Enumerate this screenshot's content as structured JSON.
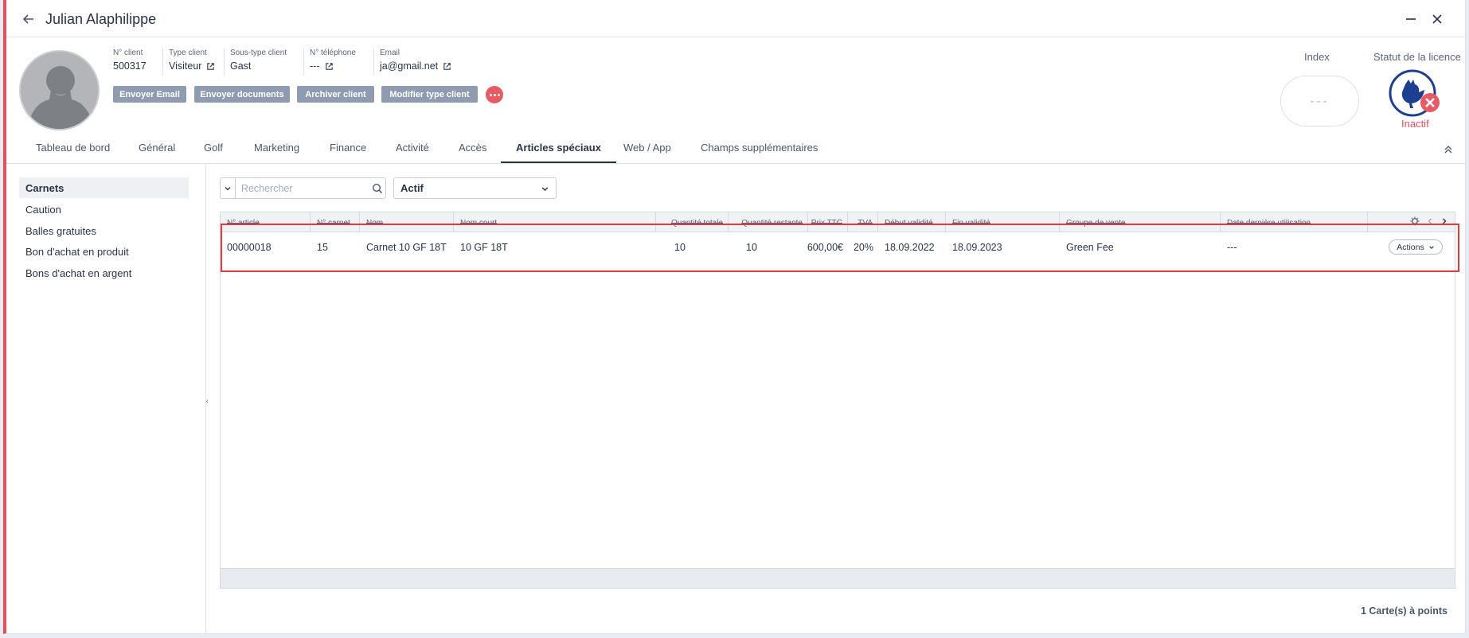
{
  "window": {
    "title": "Julian Alaphilippe"
  },
  "client": {
    "fields": [
      {
        "label": "N° client",
        "value": "500317",
        "link": false
      },
      {
        "label": "Type client",
        "value": "Visiteur",
        "link": true
      },
      {
        "label": "Sous-type client",
        "value": "Gast",
        "link": false
      },
      {
        "label": "N° téléphone",
        "value": "---",
        "link": true
      },
      {
        "label": "Email",
        "value": "ja@gmail.net",
        "link": true
      }
    ],
    "buttons": [
      "Envoyer Email",
      "Envoyer documents",
      "Archiver client",
      "Modifier type client"
    ],
    "index": {
      "label": "Index",
      "value": "---"
    },
    "license": {
      "label": "Statut de la licence",
      "status": "Inactif"
    }
  },
  "tabs": [
    "Tableau de bord",
    "Général",
    "Golf",
    "Marketing",
    "Finance",
    "Activité",
    "Accès",
    "Articles spéciaux",
    "Web / App",
    "Champs supplémentaires"
  ],
  "active_tab": "Articles spéciaux",
  "sidebar": {
    "items": [
      "Carnets",
      "Caution",
      "Balles gratuites",
      "Bon d'achat en produit",
      "Bons d'achat en argent"
    ],
    "active": "Carnets"
  },
  "toolbar": {
    "search_placeholder": "Rechercher",
    "status_filter": "Actif"
  },
  "table": {
    "columns": [
      "N° article",
      "N° carnet",
      "Nom",
      "Nom court",
      "Quantité totale",
      "Quantité restante",
      "Prix TTC",
      "TVA",
      "Début validité",
      "Fin validité",
      "Groupe de vente",
      "Date dernière utilisation"
    ],
    "rows": [
      {
        "article": "00000018",
        "carnet": "15",
        "nom": "Carnet 10 GF 18T",
        "nom_court": "10 GF 18T",
        "qte_totale": "10",
        "qte_restante": "10",
        "prix": "600,00€",
        "tva": "20%",
        "debut": "18.09.2022",
        "fin": "18.09.2023",
        "groupe": "Green Fee",
        "derniere": "---",
        "action": "Actions"
      }
    ]
  },
  "footer": {
    "count": "1 Carte(s) à points"
  },
  "colors": {
    "accent": "#e84e5c",
    "button": "#8f9bb0",
    "highlight": "#e4393f",
    "brand_blue": "#1d3f8f"
  }
}
